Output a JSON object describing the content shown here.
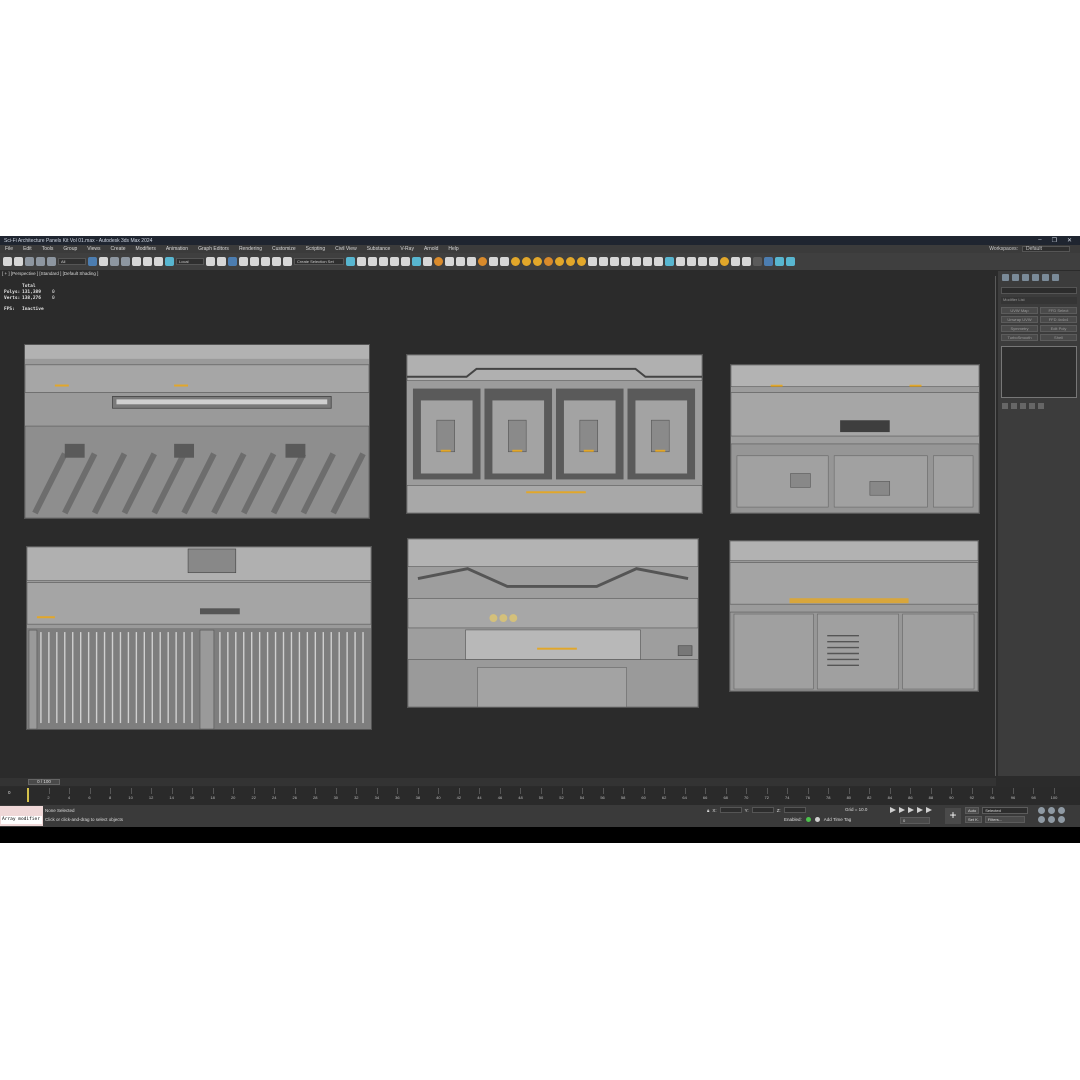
{
  "window": {
    "title": "Sci-Fi Architecture Panels Kit Vol 01.max - Autodesk 3ds Max 2024",
    "controls": [
      "–",
      "❐",
      "✕"
    ]
  },
  "menu": {
    "items": [
      "File",
      "Edit",
      "Tools",
      "Group",
      "Views",
      "Create",
      "Modifiers",
      "Animation",
      "Graph Editors",
      "Rendering",
      "Customize",
      "Scripting",
      "Civil View",
      "Substance",
      "V-Ray",
      "Arnold",
      "Help"
    ],
    "workspace_label": "Workspaces:",
    "workspace_value": "Default"
  },
  "toolbar": {
    "filter_dropdown": "All",
    "coord_dropdown": "Local",
    "selection_set": "Create Selection Set"
  },
  "viewport": {
    "label": "[ + ] [Perspective ] [Standard ] [Default Shading ]",
    "stats": {
      "total_label": "Total",
      "polys_label": "Polys:",
      "polys_value": "131,389",
      "polys_sel": "0",
      "verts_label": "Verts:",
      "verts_value": "138,276",
      "verts_sel": "0",
      "fps_label": "FPS:",
      "fps_value": "Inactive"
    }
  },
  "command_panel": {
    "modifier_list": "Modifier List",
    "buttons": [
      "UVW Map",
      "FFD Select",
      "Unwrap UVW",
      "FFD 4x4x4",
      "Symmetry",
      "Edit Poly",
      "TurboSmooth",
      "Shell"
    ]
  },
  "timeline": {
    "slider_label": "0 / 100",
    "frame_marker": "0",
    "ticks": [
      "2",
      "4",
      "6",
      "8",
      "10",
      "12",
      "14",
      "16",
      "18",
      "20",
      "22",
      "24",
      "26",
      "28",
      "30",
      "32",
      "34",
      "36",
      "38",
      "40",
      "42",
      "44",
      "46",
      "48",
      "50",
      "52",
      "54",
      "56",
      "58",
      "60",
      "62",
      "64",
      "66",
      "68",
      "70",
      "72",
      "74",
      "76",
      "78",
      "80",
      "82",
      "84",
      "86",
      "88",
      "90",
      "92",
      "94",
      "96",
      "98",
      "100"
    ]
  },
  "status": {
    "maxscript_text": "Array modifier",
    "selection_msg": "None Selected",
    "hint_msg": "Click or click-and-drag to select objects",
    "x_label": "X:",
    "y_label": "Y:",
    "z_label": "Z:",
    "grid": "Grid = 10.0",
    "enabled_label": "Enabled:",
    "add_time_tag": "Add Time Tag",
    "auto_label": "Auto",
    "selected_value": "Selected",
    "setk_label": "Set K.",
    "filters_label": "Filters...",
    "frame_field": "0"
  },
  "colors": {
    "accent": "#4c7db0",
    "panel_gray": "#8f8f8f",
    "viewport_bg": "#2b2b2b",
    "light_yellow": "#e2a72a"
  }
}
